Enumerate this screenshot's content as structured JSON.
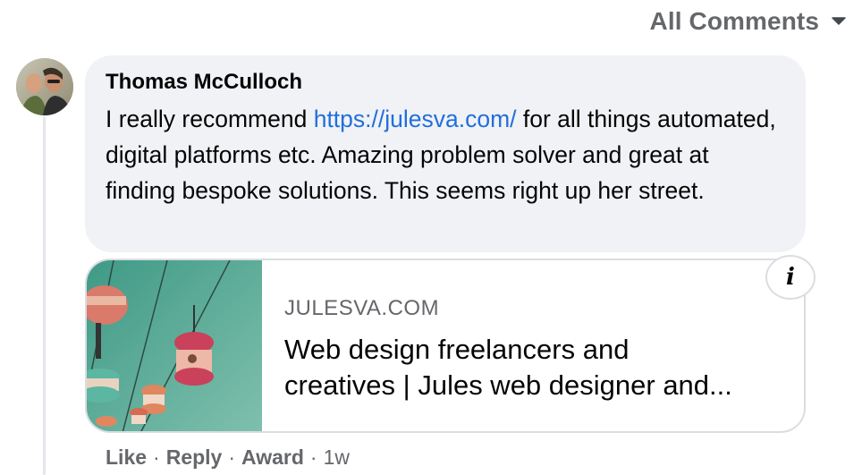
{
  "filter": {
    "label": "All Comments",
    "icon": "caret-down-icon"
  },
  "comment": {
    "author": "Thomas McCulloch",
    "avatar_icon": "user-avatar",
    "text_before": "I really recommend ",
    "link_text": "https://julesva.com/",
    "text_after": " for all things automated, digital platforms etc. Amazing problem solver and great at finding bespoke solutions. This seems right up her street.",
    "link_color": "#216fdb",
    "bubble_color": "#f0f2f5"
  },
  "link_preview": {
    "domain": "JULESVA.COM",
    "title_line1": "Web design freelancers and",
    "title_line2": "creatives | Jules web designer and...",
    "info_icon": "info-icon",
    "image_icon": "cable-car-photo"
  },
  "actions": {
    "like": "Like",
    "reply": "Reply",
    "award": "Award",
    "separator": "·",
    "time": "1w"
  }
}
